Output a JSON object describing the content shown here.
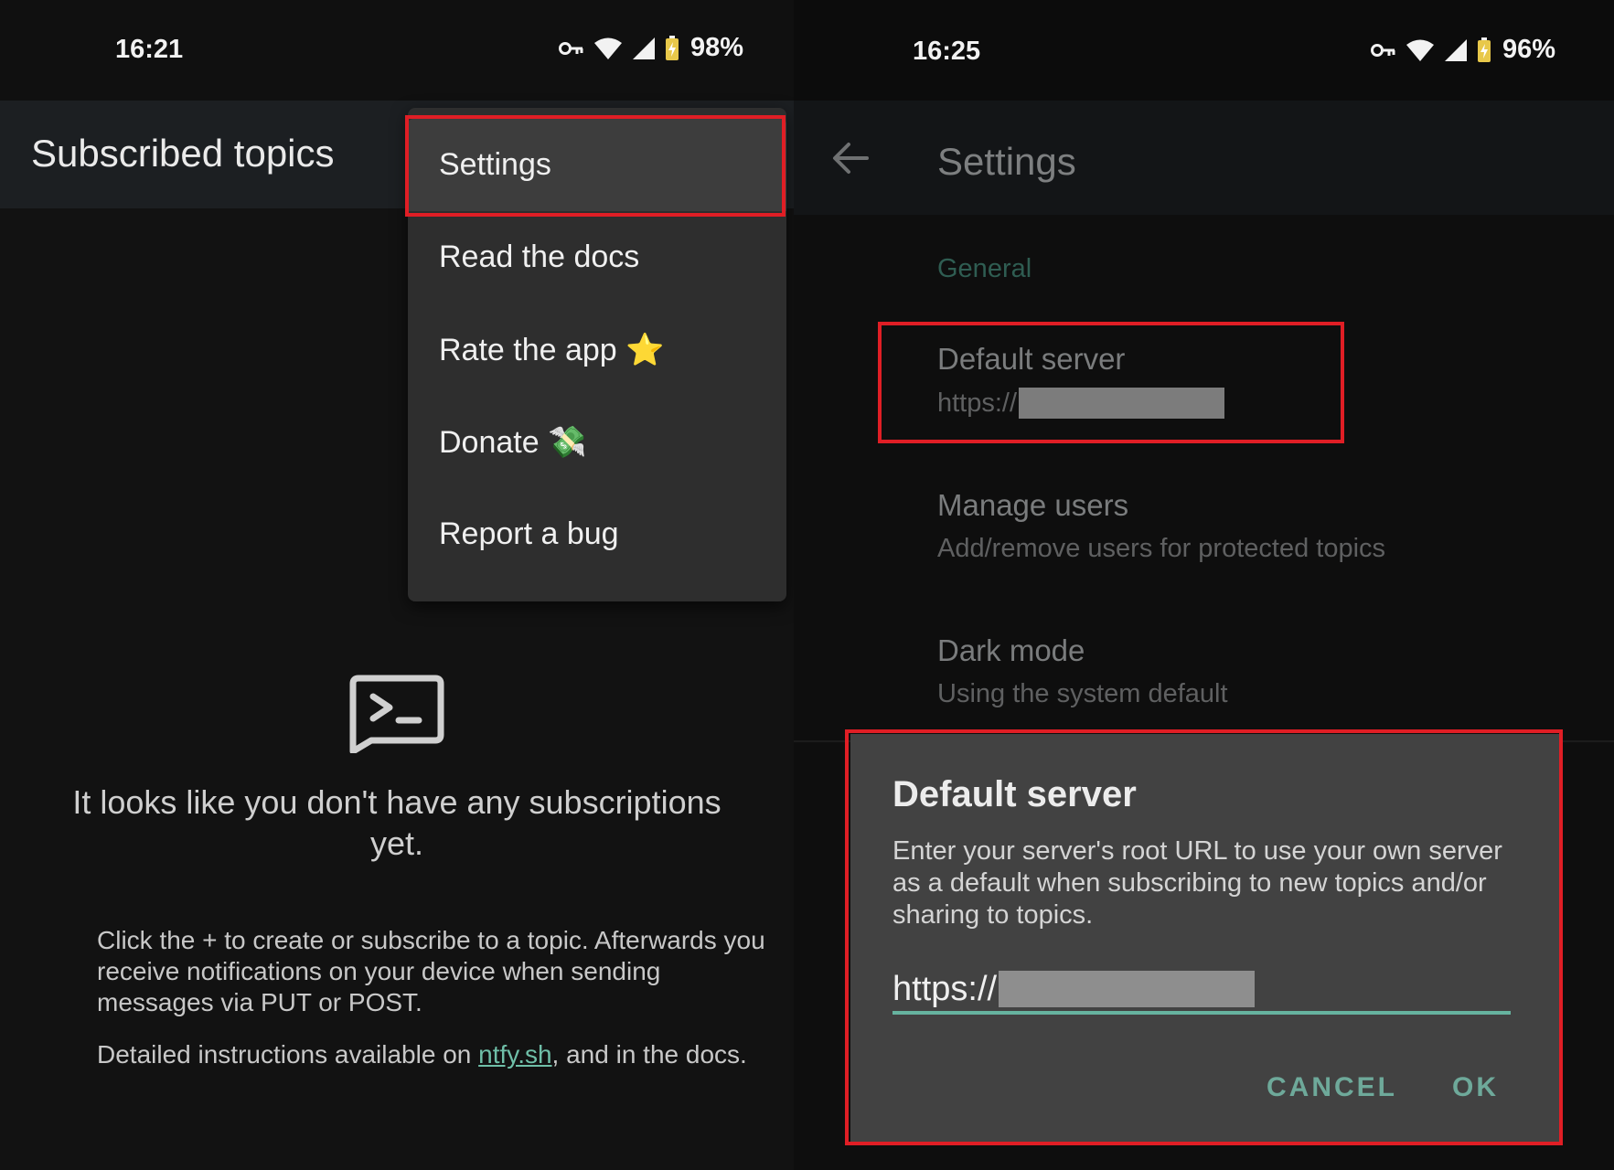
{
  "left": {
    "status": {
      "time": "16:21",
      "battery": "98%"
    },
    "appbar": {
      "title": "Subscribed topics"
    },
    "menu": {
      "items": [
        {
          "label": "Settings"
        },
        {
          "label": "Read the docs"
        },
        {
          "label": "Rate the app ⭐"
        },
        {
          "label": "Donate 💸"
        },
        {
          "label": "Report a bug"
        }
      ]
    },
    "empty": {
      "title": "It looks like you don't have any subscriptions yet.",
      "body": "Click the + to create or subscribe to a topic. Afterwards you receive notifications on your device when sending messages via PUT or POST.",
      "details_prefix": "Detailed instructions available on ",
      "details_link": "ntfy.sh",
      "details_suffix": ", and in the docs."
    }
  },
  "right": {
    "status": {
      "time": "16:25",
      "battery": "96%"
    },
    "appbar": {
      "title": "Settings"
    },
    "category": "General",
    "prefs": [
      {
        "title": "Default server",
        "summary": "https://"
      },
      {
        "title": "Manage users",
        "summary": "Add/remove users for protected topics"
      },
      {
        "title": "Dark mode",
        "summary": "Using the system default"
      }
    ],
    "dialog": {
      "title": "Default server",
      "message": "Enter your server's root URL to use your own server as a default when subscribing to new topics and/or sharing to topics.",
      "input_value": "https://",
      "cancel": "CANCEL",
      "ok": "OK"
    }
  },
  "colors": {
    "highlight": "#e01e25",
    "accent": "#66b39f",
    "dialog_bg": "#424242",
    "menu_bg": "#2e2e2e"
  },
  "icons": {
    "status": [
      "vpn-key-icon",
      "wifi-icon",
      "signal-icon",
      "battery-icon"
    ],
    "empty": "terminal-chat-icon",
    "back": "back-arrow-icon"
  }
}
